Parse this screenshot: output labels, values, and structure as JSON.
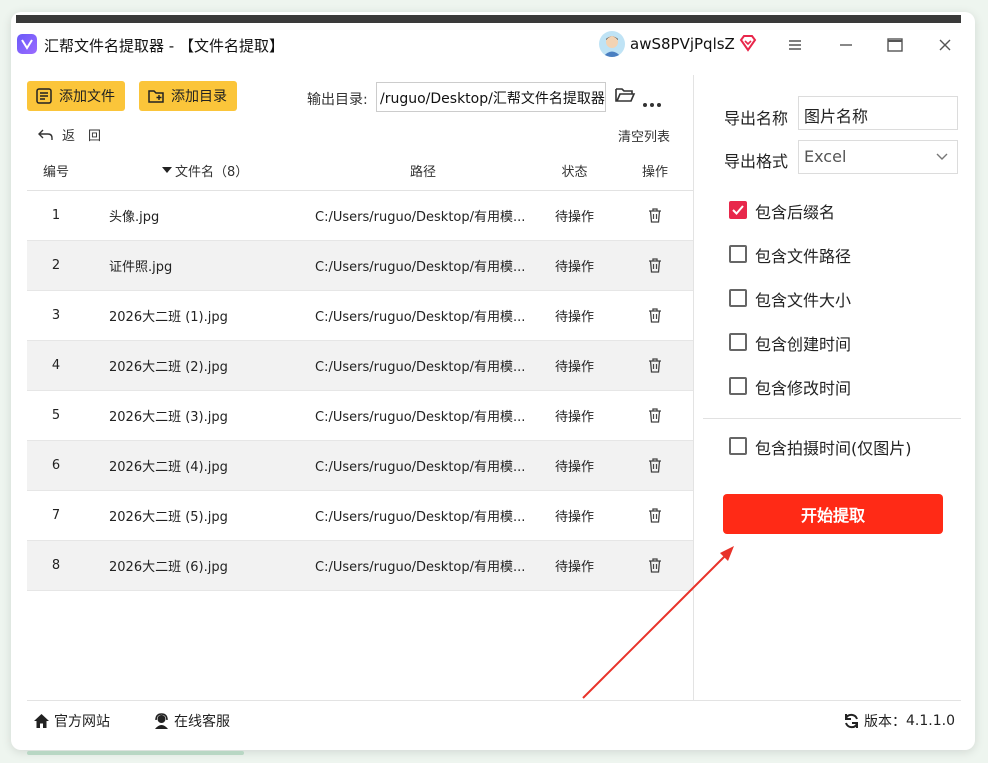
{
  "window": {
    "title": "汇帮文件名提取器 - 【文件名提取】",
    "username": "awS8PVjPqlsZ"
  },
  "toolbar": {
    "add_file_label": "添加文件",
    "add_dir_label": "添加目录",
    "output_label": "输出目录:",
    "output_path": "/ruguo/Desktop/汇帮文件名提取器",
    "back_label": "返　回",
    "clear_label": "清空列表"
  },
  "table": {
    "headers": {
      "num": "编号",
      "name": "文件名（8）",
      "path": "路径",
      "status": "状态",
      "op": "操作"
    },
    "rows": [
      {
        "num": "1",
        "name": "头像.jpg",
        "path": "C:/Users/ruguo/Desktop/有用模...",
        "status": "待操作"
      },
      {
        "num": "2",
        "name": "证件照.jpg",
        "path": "C:/Users/ruguo/Desktop/有用模...",
        "status": "待操作"
      },
      {
        "num": "3",
        "name": "2026大二班 (1).jpg",
        "path": "C:/Users/ruguo/Desktop/有用模...",
        "status": "待操作"
      },
      {
        "num": "4",
        "name": "2026大二班 (2).jpg",
        "path": "C:/Users/ruguo/Desktop/有用模...",
        "status": "待操作"
      },
      {
        "num": "5",
        "name": "2026大二班 (3).jpg",
        "path": "C:/Users/ruguo/Desktop/有用模...",
        "status": "待操作"
      },
      {
        "num": "6",
        "name": "2026大二班 (4).jpg",
        "path": "C:/Users/ruguo/Desktop/有用模...",
        "status": "待操作"
      },
      {
        "num": "7",
        "name": "2026大二班 (5).jpg",
        "path": "C:/Users/ruguo/Desktop/有用模...",
        "status": "待操作"
      },
      {
        "num": "8",
        "name": "2026大二班 (6).jpg",
        "path": "C:/Users/ruguo/Desktop/有用模...",
        "status": "待操作"
      }
    ]
  },
  "panel": {
    "export_name_label": "导出名称",
    "export_name_value": "图片名称",
    "export_format_label": "导出格式",
    "export_format_value": "Excel",
    "options": [
      {
        "label": "包含后缀名",
        "checked": true
      },
      {
        "label": "包含文件路径",
        "checked": false
      },
      {
        "label": "包含文件大小",
        "checked": false
      },
      {
        "label": "包含创建时间",
        "checked": false
      },
      {
        "label": "包含修改时间",
        "checked": false
      },
      {
        "label": "包含拍摄时间(仅图片)",
        "checked": false
      }
    ],
    "start_label": "开始提取"
  },
  "footer": {
    "website_label": "官方网站",
    "service_label": "在线客服",
    "version_label": "版本：",
    "version_value": "4.1.1.0"
  },
  "colors": {
    "accent_yellow": "#fbc53a",
    "start_red": "#ff2a16",
    "checkbox_red": "#e8274b",
    "annotation_arrow": "#e8332a"
  }
}
